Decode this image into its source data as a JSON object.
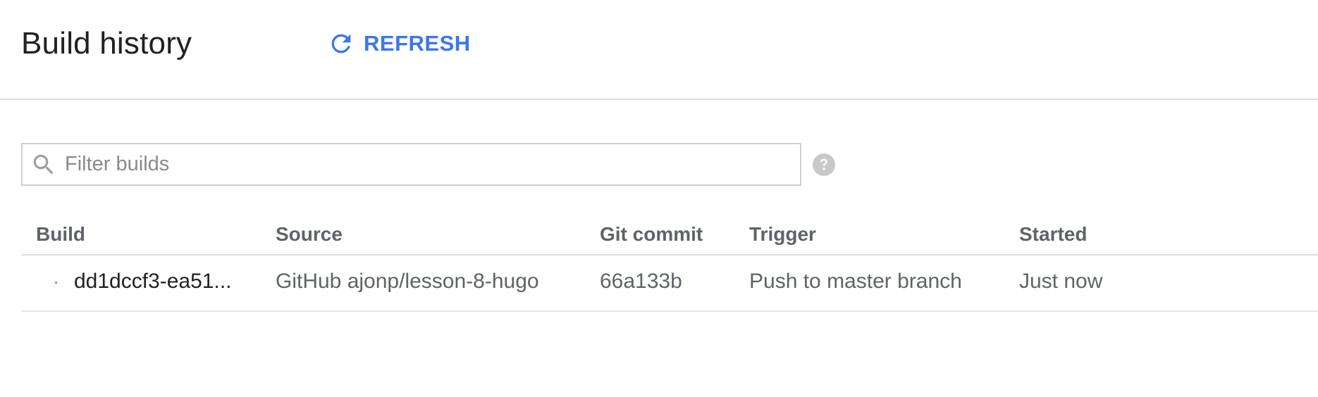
{
  "header": {
    "title": "Build history",
    "refresh_label": "REFRESH"
  },
  "filter": {
    "placeholder": "Filter builds",
    "value": ""
  },
  "table": {
    "columns": {
      "build": "Build",
      "source": "Source",
      "commit": "Git commit",
      "trigger": "Trigger",
      "started": "Started"
    },
    "rows": [
      {
        "build": "dd1dccf3-ea51...",
        "source": "GitHub ajonp/lesson-8-hugo",
        "commit": "66a133b",
        "trigger": "Push to master branch",
        "started": "Just now"
      }
    ]
  },
  "icons": {
    "refresh": "refresh-icon",
    "search": "search-icon",
    "help": "help-icon",
    "status": "status-dot-icon"
  },
  "colors": {
    "accent": "#3b78e7",
    "status_dot": "#4285f4",
    "icon_gray": "#9e9e9e",
    "help_gray": "#c8c8c8"
  }
}
